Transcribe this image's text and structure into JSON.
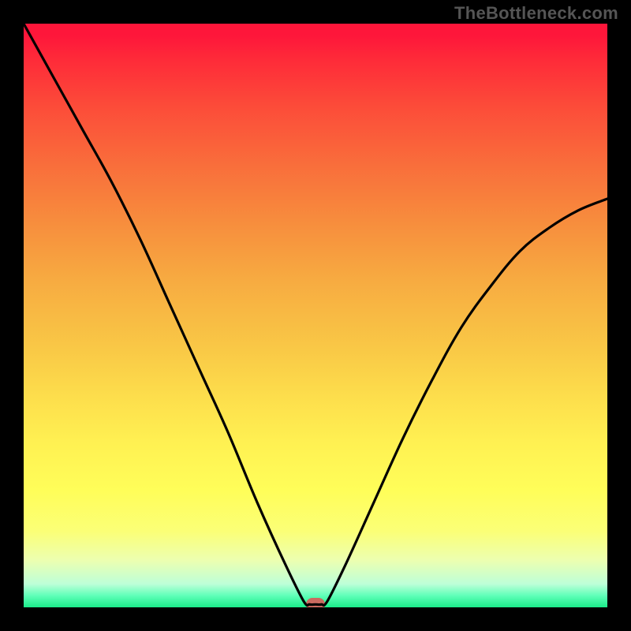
{
  "watermark": "TheBottleneck.com",
  "colors": {
    "page_bg": "#000000",
    "watermark": "#555555",
    "curve": "#000000",
    "marker": "#cb6a60",
    "gradient_top": "#fe163a",
    "gradient_bottom": "#1bec8a"
  },
  "chart_data": {
    "type": "line",
    "title": "",
    "xlabel": "",
    "ylabel": "",
    "xlim": [
      0,
      100
    ],
    "ylim": [
      0,
      100
    ],
    "grid": false,
    "legend": false,
    "comment": "No axis ticks or numeric labels are rendered. Values below are estimated from pixel positions (y = 0 at bottom / green, y = 100 at top / red).",
    "series": [
      {
        "name": "bottleneck-curve",
        "x": [
          0,
          5,
          10,
          15,
          20,
          25,
          30,
          35,
          40,
          45,
          48,
          49,
          50,
          51,
          52,
          55,
          60,
          65,
          70,
          75,
          80,
          85,
          90,
          95,
          100
        ],
        "values": [
          100,
          91,
          82,
          73,
          63,
          52,
          41,
          30,
          18,
          7,
          1,
          0.5,
          0.5,
          0.5,
          1,
          7,
          18,
          29,
          39,
          48,
          55,
          61,
          65,
          68,
          70
        ]
      }
    ],
    "annotations": [
      {
        "name": "minimum-marker",
        "x": 50,
        "y": 0.5
      }
    ]
  }
}
